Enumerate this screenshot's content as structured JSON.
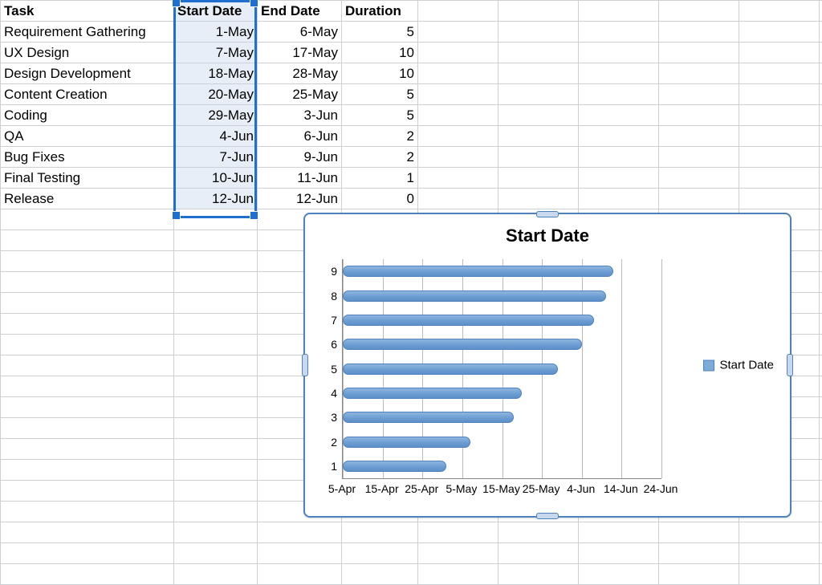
{
  "headers": {
    "task": "Task",
    "start": "Start Date",
    "end": "End Date",
    "duration": "Duration"
  },
  "rows": [
    {
      "task": "Requirement Gathering",
      "start": "1-May",
      "end": "6-May",
      "duration": "5"
    },
    {
      "task": "UX Design",
      "start": "7-May",
      "end": "17-May",
      "duration": "10"
    },
    {
      "task": "Design Development",
      "start": "18-May",
      "end": "28-May",
      "duration": "10"
    },
    {
      "task": "Content Creation",
      "start": "20-May",
      "end": "25-May",
      "duration": "5"
    },
    {
      "task": "Coding",
      "start": "29-May",
      "end": "3-Jun",
      "duration": "5"
    },
    {
      "task": "QA",
      "start": "4-Jun",
      "end": "6-Jun",
      "duration": "2"
    },
    {
      "task": "Bug Fixes",
      "start": "7-Jun",
      "end": "9-Jun",
      "duration": "2"
    },
    {
      "task": "Final Testing",
      "start": "10-Jun",
      "end": "11-Jun",
      "duration": "1"
    },
    {
      "task": "Release",
      "start": "12-Jun",
      "end": "12-Jun",
      "duration": "0"
    }
  ],
  "chart": {
    "title": "Start Date",
    "legend": "Start Date"
  },
  "chart_data": {
    "type": "bar",
    "title": "Start Date",
    "orientation": "horizontal",
    "x_axis": {
      "type": "date",
      "min": "5-Apr",
      "max": "24-Jun",
      "ticks": [
        "5-Apr",
        "15-Apr",
        "25-Apr",
        "5-May",
        "15-May",
        "25-May",
        "4-Jun",
        "14-Jun",
        "24-Jun"
      ]
    },
    "y_axis": {
      "categories": [
        "1",
        "2",
        "3",
        "4",
        "5",
        "6",
        "7",
        "8",
        "9"
      ]
    },
    "series": [
      {
        "name": "Start Date",
        "color": "#7cabd8",
        "values_as_dates": [
          "1-May",
          "7-May",
          "18-May",
          "20-May",
          "29-May",
          "4-Jun",
          "7-Jun",
          "10-Jun",
          "12-Jun"
        ],
        "bar_start": "5-Apr"
      }
    ],
    "notes": "Each horizontal bar runs from the axis origin (5-Apr) to the listed Start Date value; category 1 is at the bottom, 9 at the top."
  }
}
